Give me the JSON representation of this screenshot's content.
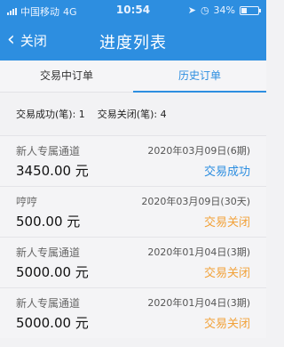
{
  "status_bar": {
    "carrier": "中国移动",
    "network": "4G",
    "time": "10:54",
    "battery": "34%",
    "battery_level": 0.34
  },
  "nav": {
    "back_label": "关闭",
    "title": "进度列表"
  },
  "tabs": [
    {
      "label": "交易中订单",
      "active": false
    },
    {
      "label": "历史订单",
      "active": true
    }
  ],
  "summary": {
    "success_text": "交易成功(笔): 1",
    "closed_text": "交易关闭(笔): 4"
  },
  "orders": [
    {
      "name": "新人专属通道",
      "amount": "3450.00 元",
      "date": "2020年03月09日(6期)",
      "status": "交易成功",
      "status_type": "success"
    },
    {
      "name": "哼哼",
      "amount": "500.00 元",
      "date": "2020年03月09日(30天)",
      "status": "交易关闭",
      "status_type": "closed"
    },
    {
      "name": "新人专属通道",
      "amount": "5000.00 元",
      "date": "2020年01月04日(3期)",
      "status": "交易关闭",
      "status_type": "closed"
    },
    {
      "name": "新人专属通道",
      "amount": "5000.00 元",
      "date": "2020年01月04日(3期)",
      "status": "交易关闭",
      "status_type": "closed"
    }
  ],
  "colors": {
    "primary": "#2d8ee0",
    "success": "#2d8ee0",
    "closed": "#f2a23a"
  }
}
